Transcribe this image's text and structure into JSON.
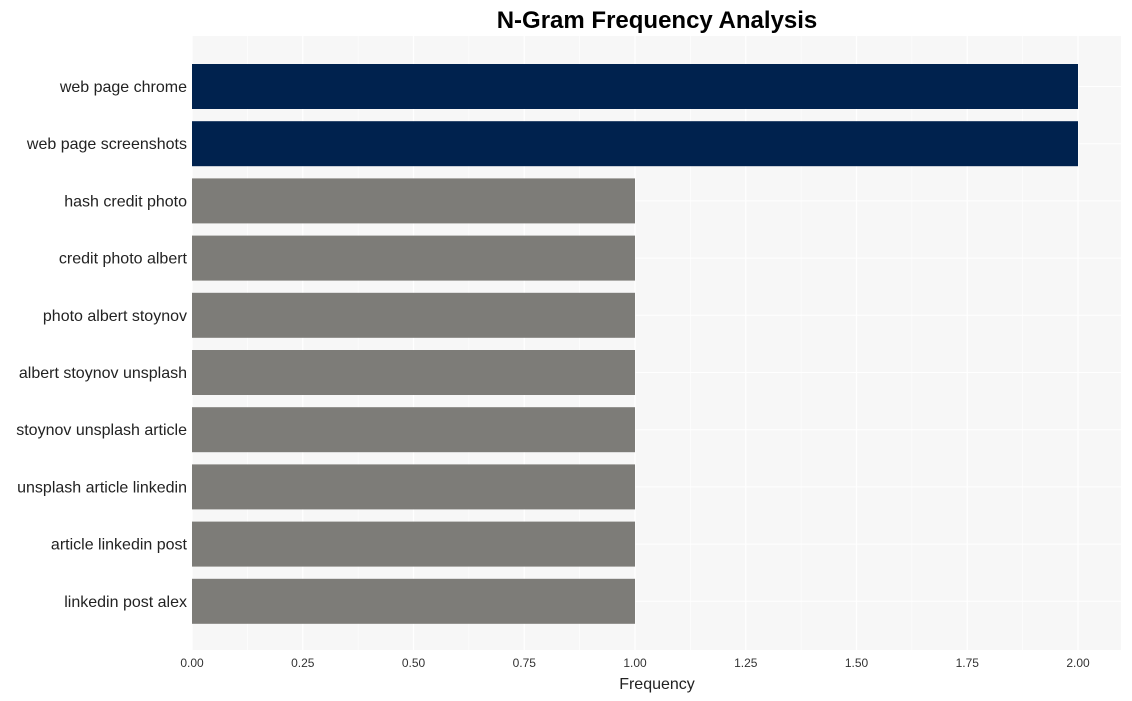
{
  "chart_data": {
    "type": "bar",
    "orientation": "horizontal",
    "title": "N-Gram Frequency Analysis",
    "xlabel": "Frequency",
    "ylabel": "",
    "xlim": [
      0,
      2.1
    ],
    "xticks": [
      0,
      0.25,
      0.5,
      0.75,
      1.0,
      1.25,
      1.5,
      1.75,
      2.0
    ],
    "xtick_labels": [
      "0.00",
      "0.25",
      "0.50",
      "0.75",
      "1.00",
      "1.25",
      "1.50",
      "1.75",
      "2.00"
    ],
    "grid": true,
    "categories": [
      "web page chrome",
      "web page screenshots",
      "hash credit photo",
      "credit photo albert",
      "photo albert stoynov",
      "albert stoynov unsplash",
      "stoynov unsplash article",
      "unsplash article linkedin",
      "article linkedin post",
      "linkedin post alex"
    ],
    "values": [
      2,
      2,
      1,
      1,
      1,
      1,
      1,
      1,
      1,
      1
    ],
    "colors": {
      "highlight": "#00224e",
      "default": "#7d7c78",
      "plot_background": "#f7f7f7",
      "grid": "#ffffff"
    }
  }
}
